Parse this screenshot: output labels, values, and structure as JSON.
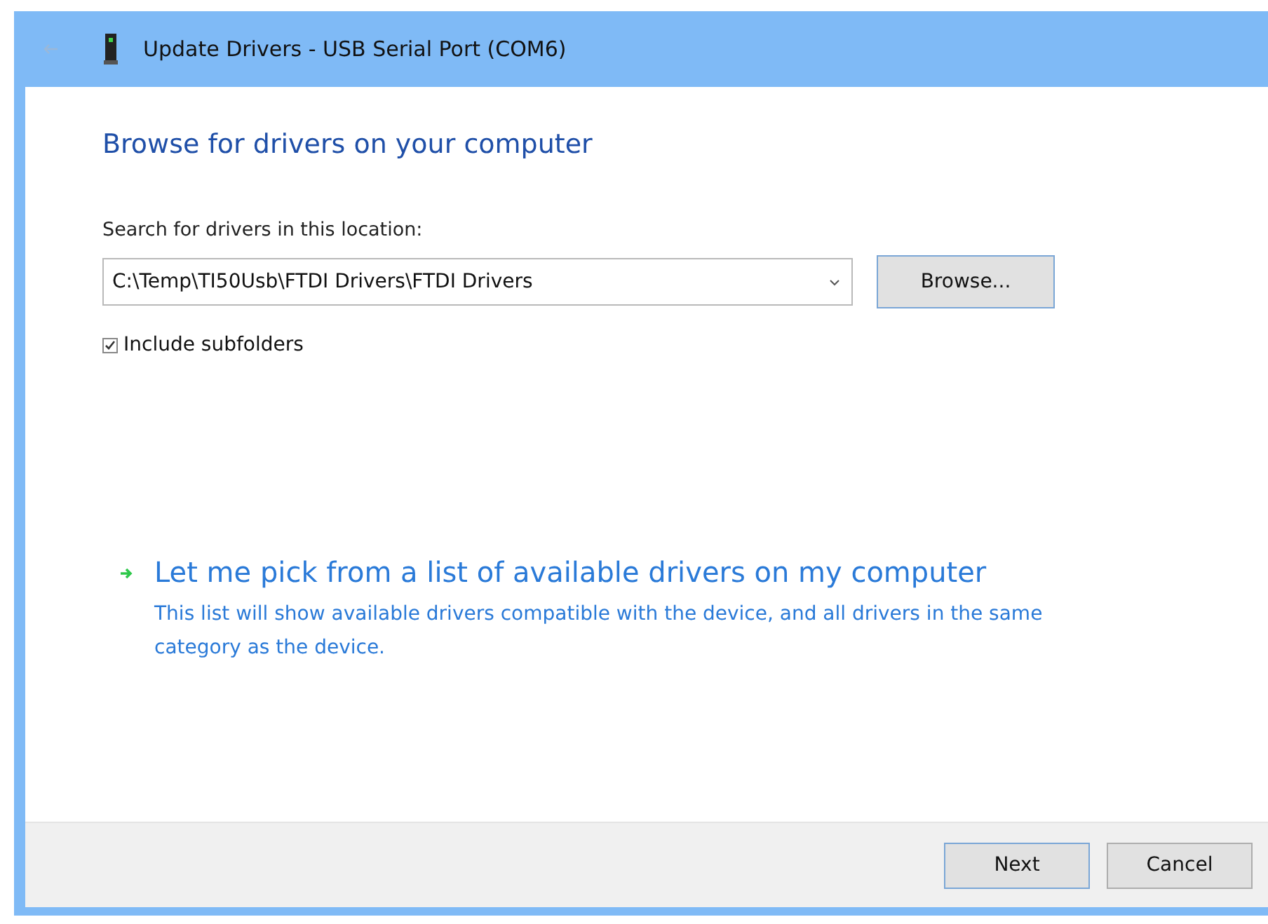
{
  "window": {
    "title": "Update Drivers - USB Serial Port (COM6)"
  },
  "heading": "Browse for drivers on your computer",
  "search": {
    "label": "Search for drivers in this location:",
    "value": "C:\\Temp\\TI50Usb\\FTDI Drivers\\FTDI Drivers",
    "browse_button": "Browse..."
  },
  "include_subfolders": {
    "label": "Include subfolders",
    "checked": true
  },
  "pick_option": {
    "title": "Let me pick from a list of available drivers on my computer",
    "description": "This list will show available drivers compatible with the device, and all drivers in the same category as the device."
  },
  "buttons": [
    {
      "label": "Next",
      "default": true
    },
    {
      "label": "Cancel",
      "default": false
    }
  ]
}
